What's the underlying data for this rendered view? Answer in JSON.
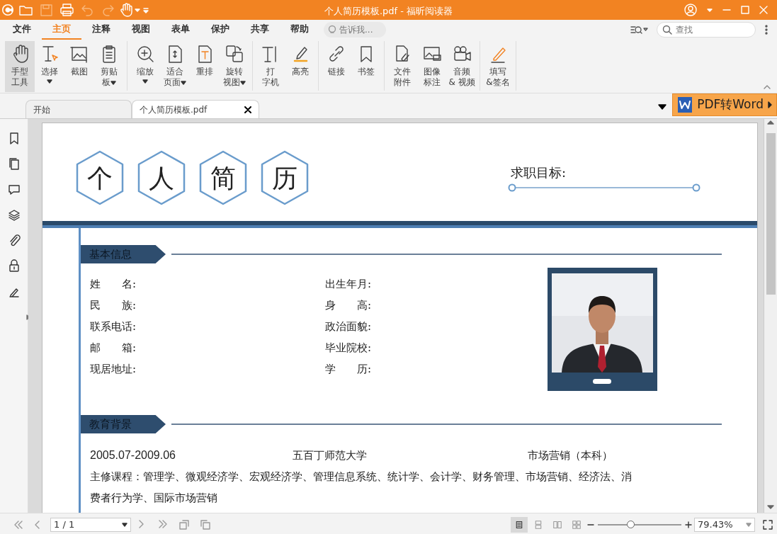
{
  "title_bar": {
    "title": "个人简历模板.pdf - 福昕阅读器"
  },
  "quick_access": [
    {
      "disabled": false
    },
    {
      "disabled": true
    },
    {
      "disabled": false
    },
    {
      "disabled": true
    },
    {
      "disabled": true
    }
  ],
  "menu_tabs": [
    {
      "label": "文件",
      "selected": false
    },
    {
      "label": "主页",
      "selected": true
    },
    {
      "label": "注释",
      "selected": false
    },
    {
      "label": "视图",
      "selected": false
    },
    {
      "label": "表单",
      "selected": false
    },
    {
      "label": "保护",
      "selected": false
    },
    {
      "label": "共享",
      "selected": false
    },
    {
      "label": "帮助",
      "selected": false
    }
  ],
  "tell_me": {
    "placeholder": "告诉我..."
  },
  "search": {
    "placeholder": "查找"
  },
  "ribbon_groups": [
    {
      "tools": [
        {
          "lines": [
            "手型",
            "工具"
          ],
          "dropdown": false,
          "selected": true
        },
        {
          "lines": [
            "选择"
          ],
          "dropdown": true,
          "selected": false
        },
        {
          "lines": [
            "截图"
          ],
          "dropdown": false,
          "selected": false
        },
        {
          "lines": [
            "剪贴",
            "板"
          ],
          "dropdown": true,
          "selected": false
        }
      ]
    },
    {
      "tools": [
        {
          "lines": [
            "缩放"
          ],
          "dropdown": true,
          "selected": false
        },
        {
          "lines": [
            "适合",
            "页面"
          ],
          "dropdown": true,
          "selected": false
        },
        {
          "lines": [
            "重排"
          ],
          "dropdown": false,
          "selected": false
        },
        {
          "lines": [
            "旋转",
            "视图"
          ],
          "dropdown": true,
          "selected": false
        }
      ]
    },
    {
      "tools": [
        {
          "lines": [
            "打",
            "字机"
          ],
          "dropdown": false,
          "selected": false
        },
        {
          "lines": [
            "高亮"
          ],
          "dropdown": false,
          "selected": false
        }
      ]
    },
    {
      "tools": [
        {
          "lines": [
            "链接"
          ],
          "dropdown": false,
          "selected": false
        },
        {
          "lines": [
            "书签"
          ],
          "dropdown": false,
          "selected": false
        }
      ]
    },
    {
      "tools": [
        {
          "lines": [
            "文件",
            "附件"
          ],
          "dropdown": false,
          "selected": false
        },
        {
          "lines": [
            "图像",
            "标注"
          ],
          "dropdown": false,
          "selected": false
        },
        {
          "lines": [
            "音频",
            "& 视频"
          ],
          "dropdown": false,
          "selected": false
        }
      ]
    },
    {
      "tools": [
        {
          "lines": [
            "填写",
            "&签名"
          ],
          "dropdown": false,
          "selected": false
        }
      ]
    }
  ],
  "doc_tabs": [
    {
      "label": "开始",
      "selected": false
    },
    {
      "label": "个人简历模板.pdf",
      "selected": true
    }
  ],
  "convert_button": {
    "label": "PDF转Word"
  },
  "resume": {
    "title_chars": [
      "个",
      "人",
      "简",
      "历"
    ],
    "objective_label": "求职目标:",
    "basic_info": {
      "heading": "基本信息",
      "left_fields": [
        "姓　　名:",
        "民　　族:",
        "联系电话:",
        "邮　　箱:",
        "现居地址:"
      ],
      "right_fields": [
        "出生年月:",
        "身　　高:",
        "政治面貌:",
        "毕业院校:",
        "学　　历:"
      ]
    },
    "education": {
      "heading": "教育背景",
      "period": "2005.07-2009.06",
      "school": "五百丁师范大学",
      "major": "市场营销（本科）",
      "courses": "主修课程：管理学、微观经济学、宏观经济学、管理信息系统、统计学、会计学、财务管理、市场营销、经济法、消费者行为学、国际市场营销"
    }
  },
  "status_bar": {
    "page": "1 / 1",
    "zoom": "79.43%",
    "zoom_slider": {
      "level": 0.39
    },
    "view_modes": [
      {
        "selected": true
      },
      {
        "selected": false
      },
      {
        "selected": false
      },
      {
        "selected": false
      }
    ]
  }
}
